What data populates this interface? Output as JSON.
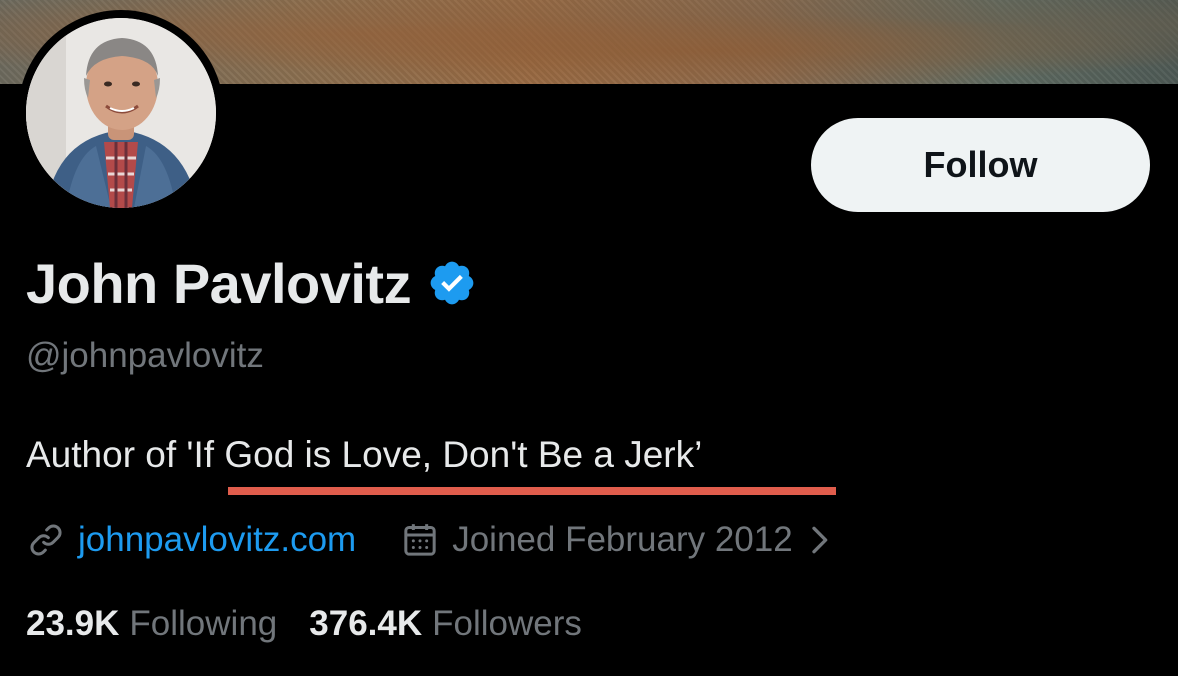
{
  "profile": {
    "display_name": "John Pavlovitz",
    "handle": "@johnpavlovitz",
    "verified": true,
    "bio": "Author of 'If God is Love, Don't Be a Jerk’",
    "website": "johnpavlovitz.com",
    "joined": "Joined February 2012"
  },
  "actions": {
    "follow_label": "Follow"
  },
  "stats": {
    "following_count": "23.9K",
    "following_label": "Following",
    "followers_count": "376.4K",
    "followers_label": "Followers"
  },
  "icons": {
    "verified": "verified-badge-icon",
    "website": "link-icon",
    "joined": "calendar-icon",
    "joined_more": "chevron-right-icon"
  },
  "colors": {
    "background": "#000000",
    "primary_text": "#e7e9ea",
    "secondary_text": "#71767b",
    "link": "#1d9bf0",
    "verified": "#1d9bf0",
    "follow_button_bg": "#eff3f4",
    "follow_button_text": "#0f1419",
    "annotation_underline": "#e05d4c"
  }
}
